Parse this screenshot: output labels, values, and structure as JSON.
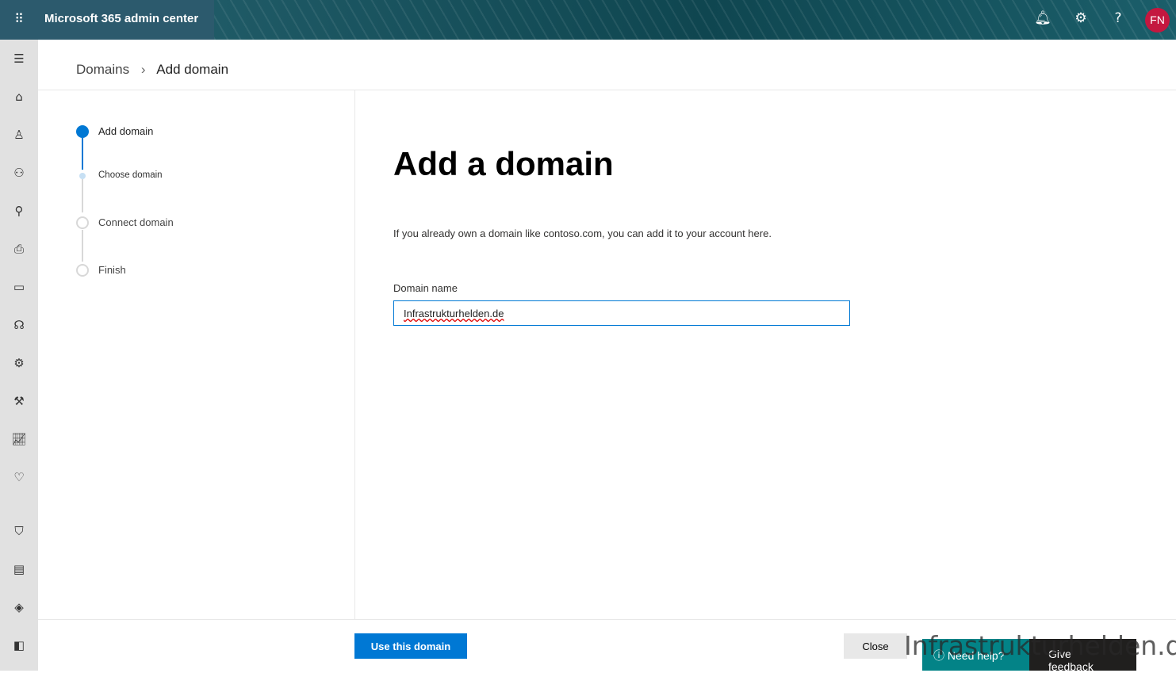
{
  "header": {
    "title": "Microsoft 365 admin center",
    "avatar_initials": "FN",
    "colors": {
      "avatar": "#c4173f",
      "accent": "#0078d4"
    }
  },
  "leftnav": [
    "menu-icon",
    "home-icon",
    "user-icon",
    "groups-icon",
    "roles-icon",
    "resources-icon",
    "billing-icon",
    "support-icon",
    "settings-icon",
    "setup-icon",
    "reports-icon",
    "health-icon",
    "security-icon",
    "compliance-icon",
    "endpoint-manager-icon",
    "exchange-icon"
  ],
  "breadcrumb": {
    "parent": "Domains",
    "current": "Add domain"
  },
  "steps": [
    {
      "label": "Add domain",
      "state": "current"
    },
    {
      "label": "Choose domain",
      "state": "substep"
    },
    {
      "label": "Connect domain",
      "state": "pending"
    },
    {
      "label": "Finish",
      "state": "pending"
    }
  ],
  "main": {
    "title": "Add a domain",
    "description": "If you already own a domain like contoso.com, you can add it to your account here.",
    "field_label": "Domain name",
    "field_value": "Infrastrukturhelden.de"
  },
  "footer": {
    "primary": "Use this domain",
    "close": "Close",
    "help": "Need help?",
    "feedback": "Give feedback"
  },
  "watermark": "Infrastrukturhelden.de"
}
